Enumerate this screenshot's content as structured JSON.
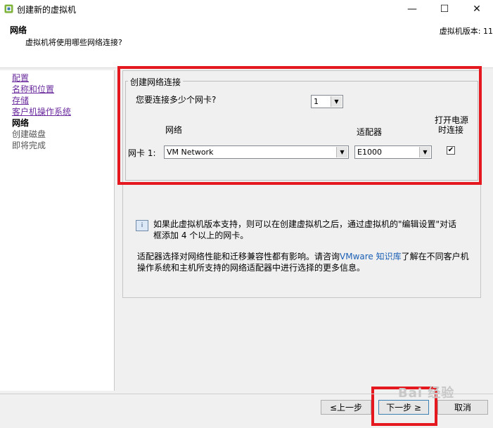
{
  "window": {
    "title": "创建新的虚拟机",
    "minimize_glyph": "—",
    "maximize_glyph": "☐",
    "close_glyph": "✕"
  },
  "header": {
    "title": "网络",
    "subtitle": "虚拟机将使用哪些网络连接?",
    "version_label": "虚拟机版本: 11"
  },
  "nav": {
    "items": [
      {
        "label": "配置",
        "state": "done"
      },
      {
        "label": "名称和位置",
        "state": "done"
      },
      {
        "label": "存储",
        "state": "done"
      },
      {
        "label": "客户机操作系统",
        "state": "done"
      },
      {
        "label": "网络",
        "state": "current"
      },
      {
        "label": "创建磁盘",
        "state": "future"
      },
      {
        "label": "即将完成",
        "state": "future"
      }
    ]
  },
  "network_group": {
    "legend": "创建网络连接",
    "question": "您要连接多少个网卡?",
    "nic_count": "1",
    "col_network": "网络",
    "col_adapter": "适配器",
    "col_power_line1": "打开电源",
    "col_power_line2": "时连接",
    "nic_label": "网卡 1:",
    "nic_network": "VM Network",
    "nic_adapter": "E1000",
    "connect_at_power_on": true
  },
  "info": {
    "icon_text": "i",
    "text": "如果此虚拟机版本支持，则可以在创建虚拟机之后，通过虚拟机的\"编辑设置\"对话框添加 4 个以上的网卡。"
  },
  "adapter_note": {
    "prefix": "适配器选择对网络性能和迁移兼容性都有影响。请咨询",
    "link": "VMware 知识库",
    "suffix": "了解在不同客户机操作系统和主机所支持的网络适配器中进行选择的更多信息。"
  },
  "footer": {
    "back_label": "≤上一步",
    "next_label": "下一步 ≥",
    "cancel_label": "取消"
  },
  "watermark": "Bai 经验",
  "colors": {
    "highlight_red": "#e5171f",
    "link_blue": "#1a5fb4",
    "visited_purple": "#6b2b9e"
  }
}
